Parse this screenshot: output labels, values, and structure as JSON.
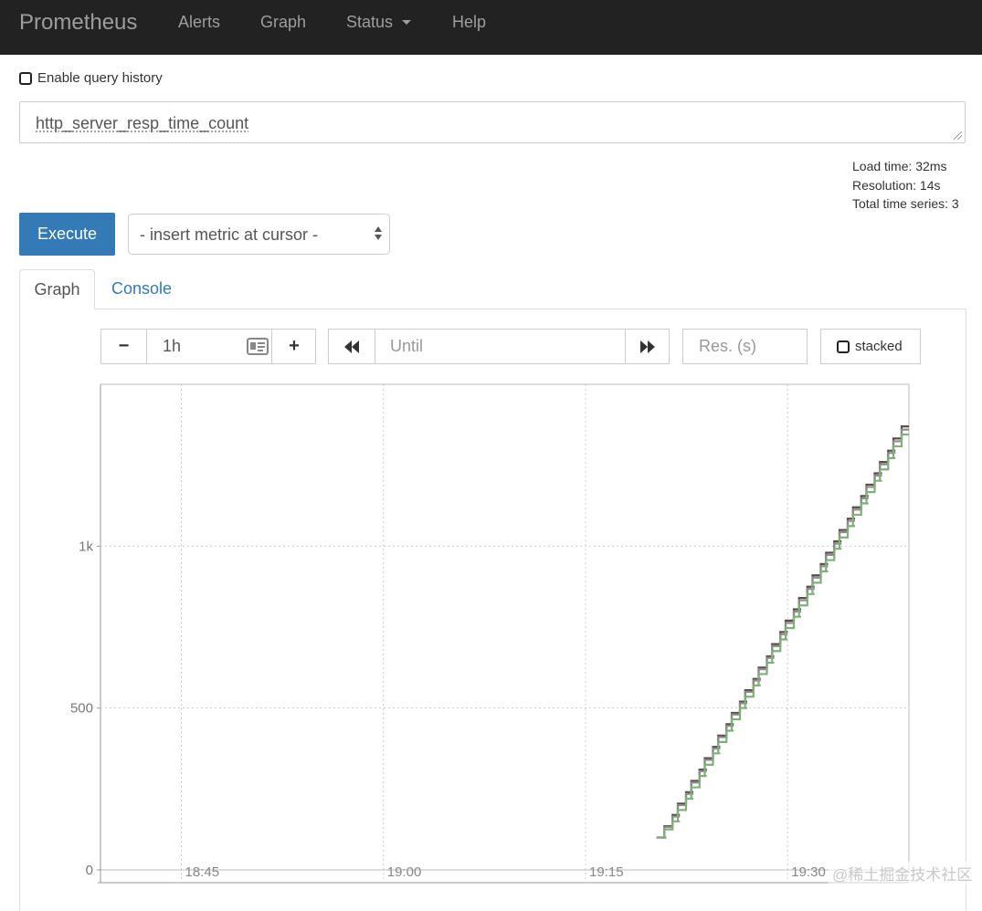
{
  "navbar": {
    "brand": "Prometheus",
    "items": [
      "Alerts",
      "Graph",
      "Status",
      "Help"
    ]
  },
  "query_history": {
    "label": "Enable query history",
    "checked": false
  },
  "expression": {
    "value": "http_server_resp_time_count"
  },
  "stats": {
    "load_time": "Load time: 32ms",
    "resolution": "Resolution: 14s",
    "total_series": "Total time series: 3"
  },
  "execute_label": "Execute",
  "metric_select": {
    "value": "- insert metric at cursor -"
  },
  "tabs": {
    "graph": "Graph",
    "console": "Console",
    "active": "graph"
  },
  "controls": {
    "minus": "−",
    "range": "1h",
    "plus": "+",
    "back": "◀◀",
    "until_placeholder": "Until",
    "forward": "▶▶",
    "resolution_placeholder": "Res. (s)",
    "stacked_label": "stacked"
  },
  "chart_data": {
    "type": "line",
    "title": "",
    "xlabel": "",
    "ylabel": "",
    "x_ticks": [
      "18:45",
      "19:00",
      "19:15",
      "19:30"
    ],
    "y_ticks": [
      "0",
      "500",
      "1k"
    ],
    "ylim": [
      0,
      1500
    ],
    "grid": true,
    "series": [
      {
        "color": "#5a4e47",
        "x": [
          "19:21",
          "19:22",
          "19:23",
          "19:24",
          "19:25",
          "19:26",
          "19:27",
          "19:28",
          "19:29",
          "19:30",
          "19:31",
          "19:32",
          "19:33",
          "19:34",
          "19:35",
          "19:36",
          "19:37",
          "19:38",
          "19:39"
        ],
        "y": [
          100,
          170,
          240,
          310,
          380,
          450,
          520,
          590,
          660,
          735,
          805,
          875,
          945,
          1015,
          1085,
          1155,
          1225,
          1295,
          1370
        ]
      },
      {
        "color": "#8c8c8c",
        "x": [
          "19:21",
          "19:22",
          "19:23",
          "19:24",
          "19:25",
          "19:26",
          "19:27",
          "19:28",
          "19:29",
          "19:30",
          "19:31",
          "19:32",
          "19:33",
          "19:34",
          "19:35",
          "19:36",
          "19:37",
          "19:38",
          "19:39"
        ],
        "y": [
          100,
          165,
          235,
          305,
          375,
          445,
          515,
          585,
          655,
          728,
          798,
          868,
          938,
          1008,
          1078,
          1148,
          1218,
          1288,
          1360
        ]
      },
      {
        "color": "#7fb07a",
        "x": [
          "19:21",
          "19:22",
          "19:23",
          "19:24",
          "19:25",
          "19:26",
          "19:27",
          "19:28",
          "19:29",
          "19:30",
          "19:31",
          "19:32",
          "19:33",
          "19:34",
          "19:35",
          "19:36",
          "19:37",
          "19:38",
          "19:39"
        ],
        "y": [
          100,
          150,
          220,
          290,
          360,
          430,
          500,
          570,
          640,
          712,
          782,
          852,
          922,
          992,
          1062,
          1132,
          1202,
          1272,
          1345
        ]
      }
    ]
  },
  "watermark": "@稀土掘金技术社区"
}
